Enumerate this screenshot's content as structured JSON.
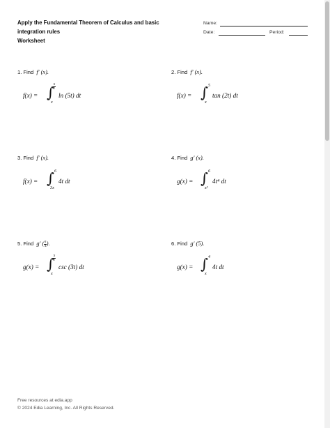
{
  "header": {
    "title_line1": "Apply the Fundamental Theorem of Calculus and basic",
    "title_line2": "integration rules",
    "subtitle": "Worksheet",
    "name_label": "Name:",
    "date_label": "Date:",
    "period_label": "Period:"
  },
  "problems": [
    {
      "number": "1.",
      "find": "Find",
      "target": "f′ (x).",
      "lhs": "f(x) =",
      "upper": "π/2",
      "lower": "x",
      "integrand": "ln (5t) dt"
    },
    {
      "number": "2.",
      "find": "Find",
      "target": "f′ (x).",
      "lhs": "f(x) =",
      "upper": "5",
      "lower": "x",
      "integrand": "tan (2t) dt"
    },
    {
      "number": "3.",
      "find": "Find",
      "target": "f′ (x).",
      "lhs": "f(x) =",
      "upper": "6",
      "lower": "3x",
      "integrand": "4t dt"
    },
    {
      "number": "4.",
      "find": "Find",
      "target": "g′ (x).",
      "lhs": "g(x) =",
      "upper": "6",
      "lower": "x²",
      "integrand": "4t⁴ dt"
    },
    {
      "number": "5.",
      "find": "Find",
      "target": "g′ (π/4).",
      "lhs": "g(x) =",
      "upper": "π/2",
      "lower": "x",
      "integrand": "csc (3t) dt"
    },
    {
      "number": "6.",
      "find": "Find",
      "target": "g′ (5).",
      "lhs": "g(x) =",
      "upper": "4",
      "lower": "x",
      "integrand": "4t dt"
    }
  ],
  "footer": {
    "line1": "Free resources at edia.app",
    "line2": "© 2024 Edia Learning, Inc. All Rights Reserved."
  }
}
